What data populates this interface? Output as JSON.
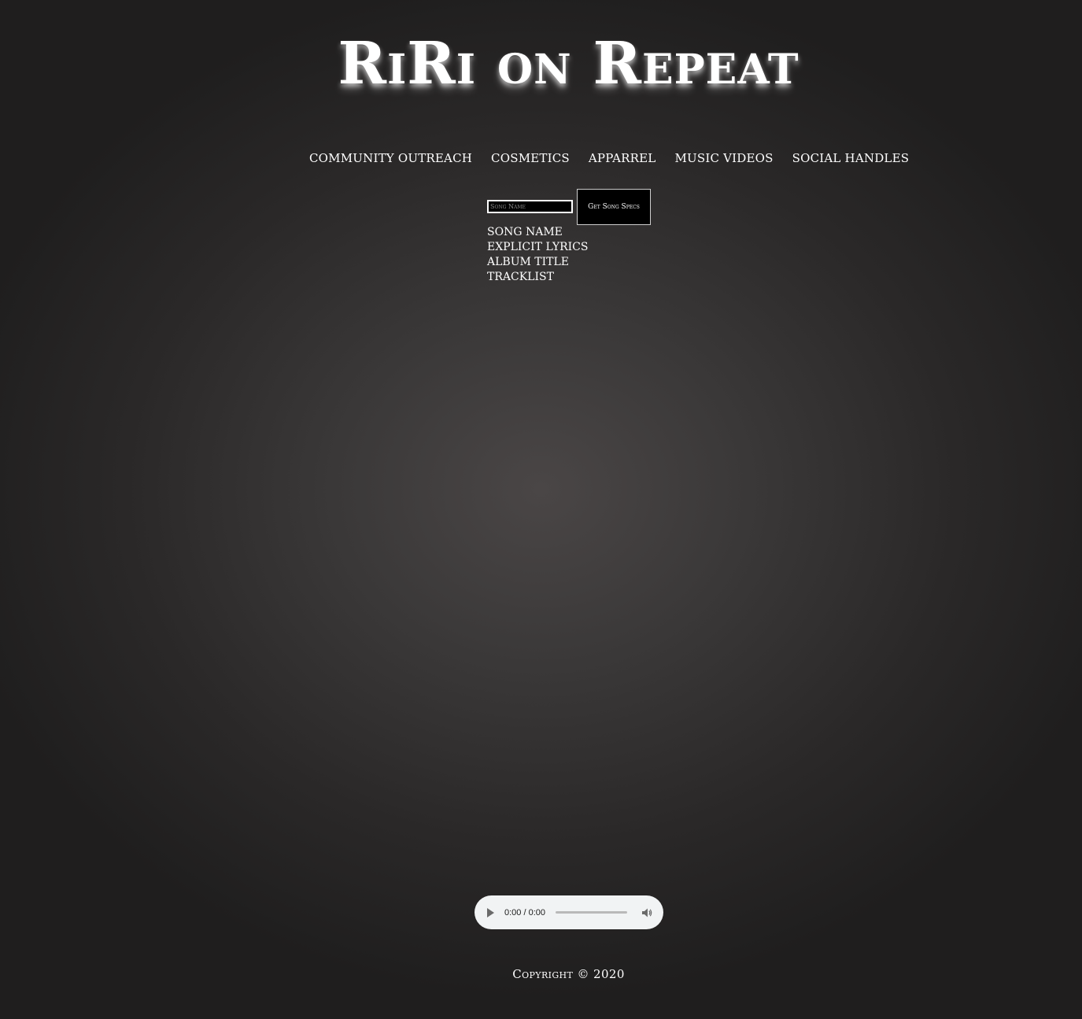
{
  "header": {
    "title": "RiRi on Repeat"
  },
  "nav": {
    "items": [
      "COMMUNITY OUTREACH",
      "COSMETICS",
      "APPARREL",
      "MUSIC VIDEOS",
      "SOCIAL HANDLES"
    ]
  },
  "search": {
    "placeholder": "Song Name",
    "value": "",
    "button_label": "Get Song Specs"
  },
  "specs": {
    "fields": [
      "SONG NAME",
      "EXPLICIT LYRICS",
      "ALBUM TITLE",
      "TRACKLIST"
    ]
  },
  "audio": {
    "time": "0:00 / 0:00",
    "progress": 0,
    "icons": {
      "play": "play-icon",
      "volume": "volume-icon"
    }
  },
  "footer": {
    "copyright": "Copyright © 2020"
  }
}
